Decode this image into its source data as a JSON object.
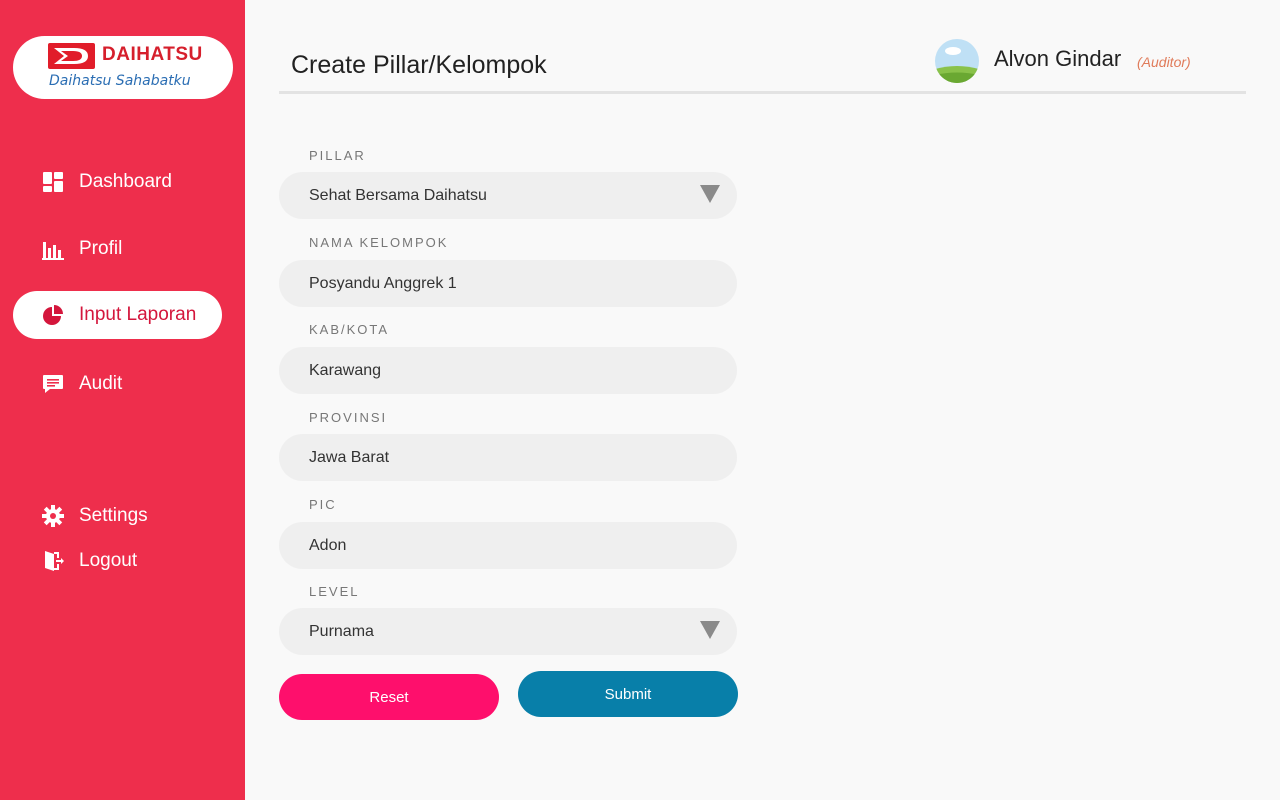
{
  "brand": {
    "name": "DAIHATSU",
    "tagline": "Daihatsu Sahabatku"
  },
  "colors": {
    "sidebar": "#ee2e4c",
    "active_text": "#d4163c",
    "reset_button": "#fe0f6c",
    "submit_button": "#087fa9",
    "role_text": "#e07b5a"
  },
  "sidebar": {
    "items": [
      {
        "label": "Dashboard",
        "icon": "dashboard-icon"
      },
      {
        "label": "Profil",
        "icon": "bar-chart-icon"
      },
      {
        "label": "Input Laporan",
        "icon": "pie-chart-icon",
        "active": true
      },
      {
        "label": "Audit",
        "icon": "message-icon"
      }
    ],
    "bottom_items": [
      {
        "label": "Settings",
        "icon": "gear-icon"
      },
      {
        "label": "Logout",
        "icon": "logout-icon"
      }
    ]
  },
  "header": {
    "title": "Create Pillar/Kelompok",
    "user": {
      "name": "Alvon Gindar",
      "role": "(Auditor)"
    }
  },
  "form": {
    "fields": [
      {
        "label": "PILLAR",
        "value": "Sehat Bersama Daihatsu",
        "type": "select"
      },
      {
        "label": "NAMA KELOMPOK",
        "value": "Posyandu Anggrek 1",
        "type": "text"
      },
      {
        "label": "KAB/KOTA",
        "value": "Karawang",
        "type": "text"
      },
      {
        "label": "PROVINSI",
        "value": "Jawa Barat",
        "type": "text"
      },
      {
        "label": "PIC",
        "value": "Adon",
        "type": "text"
      },
      {
        "label": "LEVEL",
        "value": "Purnama",
        "type": "select"
      }
    ],
    "reset_label": "Reset",
    "submit_label": "Submit"
  }
}
